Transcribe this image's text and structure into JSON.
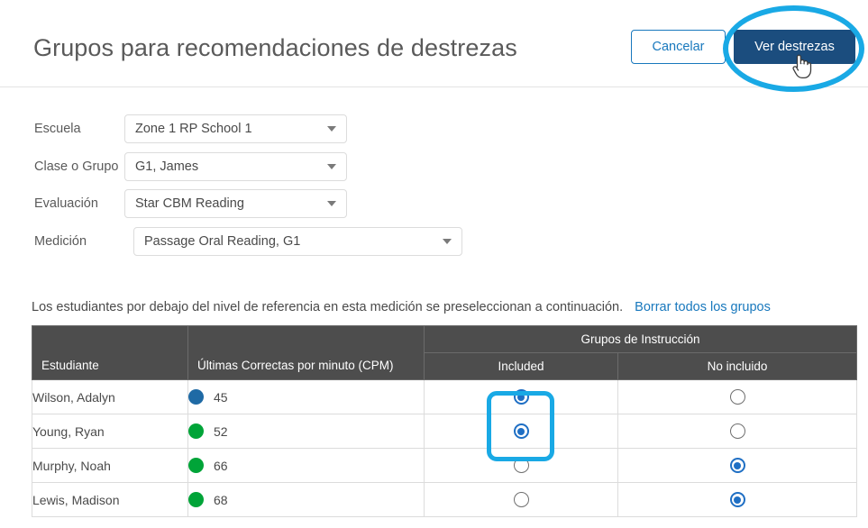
{
  "header": {
    "title": "Grupos para recomendaciones de destrezas",
    "cancel_label": "Cancelar",
    "primary_label": "Ver destrezas",
    "primary_color": "#1b4d7e",
    "link_color": "#1878bd"
  },
  "form": {
    "fields": [
      {
        "label": "Escuela",
        "value": "Zone 1 RP School 1"
      },
      {
        "label": "Clase o Grupo",
        "value": "G1, James"
      },
      {
        "label": "Evaluación",
        "value": "Star CBM Reading"
      },
      {
        "label": "Medición",
        "value": "Passage Oral Reading, G1"
      }
    ]
  },
  "instruction": {
    "text": "Los estudiantes por debajo del nivel de referencia en esta medición se preseleccionan a continuación.",
    "clear_link": "Borrar todos los grupos"
  },
  "table": {
    "group_header": "Grupos de Instrucción",
    "columns": {
      "student": "Estudiante",
      "score": "Últimas Correctas por minuto (CPM)",
      "included": "Included",
      "not_included": "No incluido"
    },
    "rows": [
      {
        "name": "Wilson, Adalyn",
        "score": "45",
        "dot_color": "#1f6aa5",
        "included": true,
        "not_included": false
      },
      {
        "name": "Young, Ryan",
        "score": "52",
        "dot_color": "#00a438",
        "included": true,
        "not_included": false
      },
      {
        "name": "Murphy, Noah",
        "score": "66",
        "dot_color": "#00a438",
        "included": false,
        "not_included": true
      },
      {
        "name": "Lewis, Madison",
        "score": "68",
        "dot_color": "#00a438",
        "included": false,
        "not_included": true
      }
    ]
  },
  "annotations": {
    "highlight_color": "#19a9e5",
    "ellipse_target": "Ver destrezas",
    "rect_target": "Included radios for first two students"
  }
}
